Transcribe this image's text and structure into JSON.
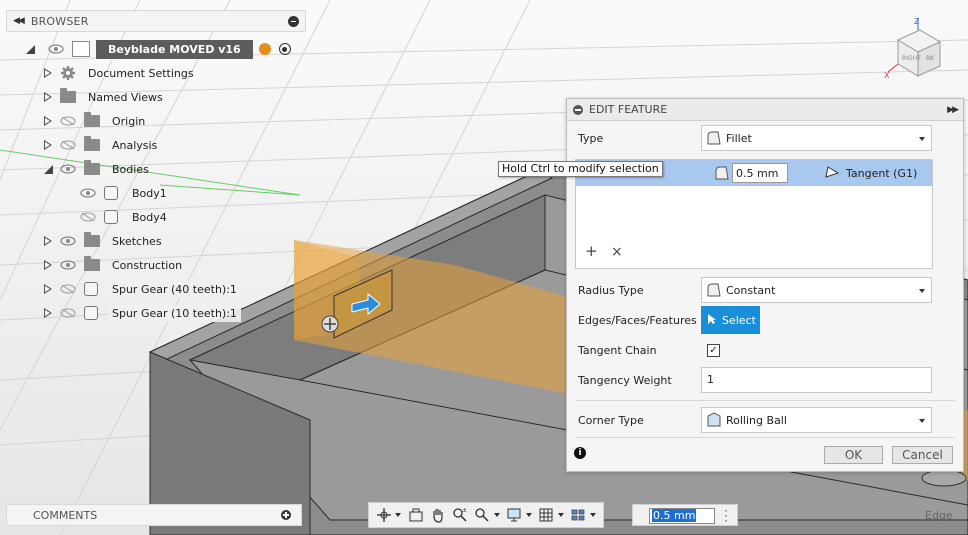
{
  "browser": {
    "header_label": "BROWSER",
    "document_name": "Beyblade MOVED v16",
    "items": [
      {
        "label": "Document Settings"
      },
      {
        "label": "Named Views"
      },
      {
        "label": "Origin"
      },
      {
        "label": "Analysis"
      },
      {
        "label": "Bodies"
      },
      {
        "label": "Body1"
      },
      {
        "label": "Body4"
      },
      {
        "label": "Sketches"
      },
      {
        "label": "Construction"
      },
      {
        "label": "Spur Gear (40 teeth):1"
      },
      {
        "label": "Spur Gear (10 teeth):1"
      }
    ]
  },
  "comments": {
    "label": "COMMENTS"
  },
  "dialog": {
    "title": "EDIT FEATURE",
    "type_label": "Type",
    "type_value": "Fillet",
    "selection_radius": "0.5 mm",
    "selection_continuity": "Tangent (G1)",
    "add_symbol": "+",
    "remove_symbol": "×",
    "radius_type_label": "Radius Type",
    "radius_type_value": "Constant",
    "edges_label": "Edges/Faces/Features",
    "select_label": "Select",
    "tangent_chain_label": "Tangent Chain",
    "tangent_chain_checked": true,
    "tangency_weight_label": "Tangency Weight",
    "tangency_weight_value": "1",
    "corner_type_label": "Corner Type",
    "corner_type_value": "Rolling Ball",
    "ok_label": "OK",
    "cancel_label": "Cancel",
    "info_symbol": "i"
  },
  "tooltip": {
    "text": "Hold Ctrl to modify selection"
  },
  "viewcube": {
    "face_right": "RIGHT",
    "face_back": "BK",
    "axis_z": "Z",
    "axis_x": "X"
  },
  "distance_input": {
    "value": "0.5 mm"
  },
  "status": {
    "selection_filter": "Edge"
  },
  "colors": {
    "accent_blue": "#1a8fd9",
    "selection_highlight": "#a9c8ef",
    "preview_orange": "#e8a33a",
    "body_gray": "#8a8a8a"
  }
}
